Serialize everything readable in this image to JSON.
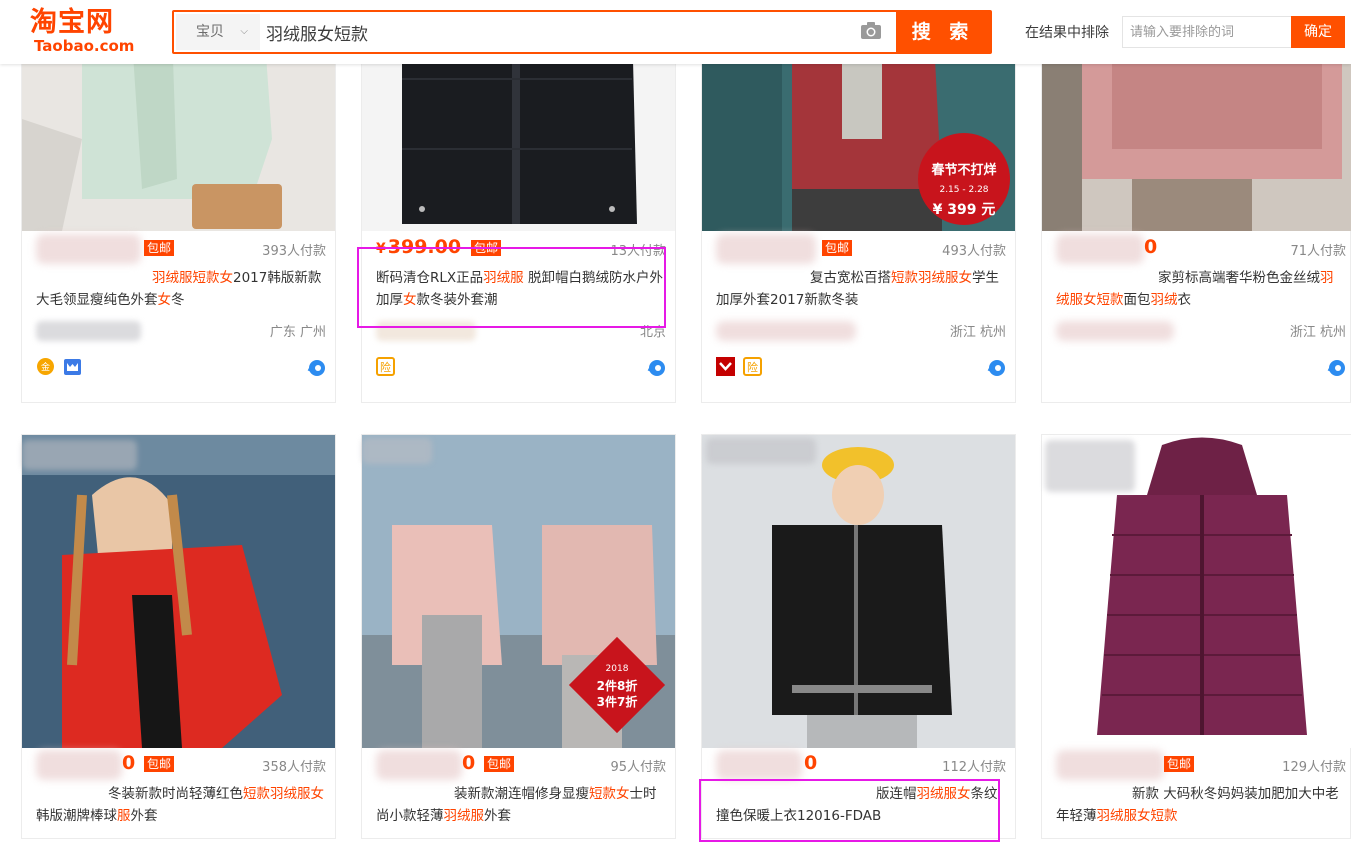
{
  "header": {
    "logo_cn": "淘宝网",
    "logo_en": "Taobao.com",
    "search_category": "宝贝",
    "search_query": "羽绒服女短款",
    "search_button": "搜 索",
    "exclude_label": "在结果中排除",
    "exclude_placeholder": "请输入要排除的词",
    "exclude_button": "确定"
  },
  "colors": {
    "accent": "#ff5000",
    "highlight_price": "#ff4400",
    "annotation": "#e619e6"
  },
  "products": [
    {
      "price": "",
      "baoyou": "包邮",
      "paid": "393人付款",
      "title_segments": [
        {
          "text": "",
          "hl": false
        },
        {
          "text": "羽绒服短款女",
          "hl": true
        },
        {
          "text": "2017韩版新款大毛领显瘦纯色外套",
          "hl": false
        },
        {
          "text": "女",
          "hl": true
        },
        {
          "text": "冬",
          "hl": false
        }
      ],
      "location": "广东 广州"
    },
    {
      "price": "399.00",
      "yen": "¥",
      "baoyou": "包邮",
      "paid": "13人付款",
      "title_segments": [
        {
          "text": "断码清仓RLX正品",
          "hl": false
        },
        {
          "text": "羽绒服",
          "hl": true
        },
        {
          "text": " 脱卸帽白鹅绒防水户外加厚",
          "hl": false
        },
        {
          "text": "女",
          "hl": true
        },
        {
          "text": "款冬装外套潮",
          "hl": false
        }
      ],
      "location": "北京"
    },
    {
      "price": "",
      "baoyou": "包邮",
      "paid": "493人付款",
      "title_segments": [
        {
          "text": "复古宽松百搭",
          "hl": false
        },
        {
          "text": "短款羽绒服女",
          "hl": true
        },
        {
          "text": "学生加厚外套2017新款冬装",
          "hl": false
        }
      ],
      "location": "浙江 杭州"
    },
    {
      "price": "0",
      "baoyou": "",
      "paid": "71人付款",
      "title_segments": [
        {
          "text": "家剪标高端奢华粉色金丝绒",
          "hl": false
        },
        {
          "text": "羽绒服女短款",
          "hl": true
        },
        {
          "text": "面包",
          "hl": false
        },
        {
          "text": "羽绒",
          "hl": true
        },
        {
          "text": "衣",
          "hl": false
        }
      ],
      "location": "浙江 杭州"
    },
    {
      "price": "0",
      "baoyou": "包邮",
      "paid": "358人付款",
      "title_segments": [
        {
          "text": "冬装新款时尚轻薄红色",
          "hl": false
        },
        {
          "text": "短款羽绒服女",
          "hl": true
        },
        {
          "text": "韩版潮牌棒球",
          "hl": false
        },
        {
          "text": "服",
          "hl": true
        },
        {
          "text": "外套",
          "hl": false
        }
      ],
      "location": ""
    },
    {
      "price": "0",
      "baoyou": "包邮",
      "paid": "95人付款",
      "title_segments": [
        {
          "text": "装新款潮连帽修身显瘦",
          "hl": false
        },
        {
          "text": "短款女",
          "hl": true
        },
        {
          "text": "士时尚小款轻薄",
          "hl": false
        },
        {
          "text": "羽绒服",
          "hl": true
        },
        {
          "text": "外套",
          "hl": false
        }
      ],
      "location": ""
    },
    {
      "price": "0",
      "baoyou": "",
      "paid": "112人付款",
      "title_segments": [
        {
          "text": "版连帽",
          "hl": false
        },
        {
          "text": "羽绒服女",
          "hl": true
        },
        {
          "text": "条纹撞色保暖上衣12016-FDAB",
          "hl": false
        }
      ],
      "location": ""
    },
    {
      "price": "",
      "baoyou": "包邮",
      "paid": "129人付款",
      "title_segments": [
        {
          "text": "新款 大码秋冬妈妈装加肥加大中老年轻薄",
          "hl": false
        },
        {
          "text": "羽绒服女短款",
          "hl": true
        }
      ],
      "location": ""
    }
  ],
  "promo_tags": {
    "spring": "春节不打烊",
    "dates": "2.15 - 2.28",
    "promo_price": "¥ 399 元",
    "year": "2018",
    "deal1": "2件8折",
    "deal2": "3件7折"
  }
}
